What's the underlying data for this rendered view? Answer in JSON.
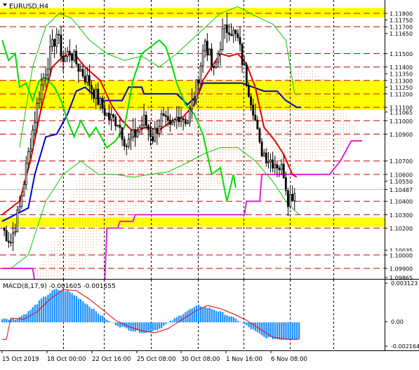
{
  "window": {
    "symbol_label": "EURUSD,H4"
  },
  "price_axis": {
    "labels": [
      "1.11800",
      "1.11750",
      "1.11700",
      "1.11650",
      "1.11500",
      "1.11400",
      "1.11350",
      "1.11300",
      "1.11250",
      "1.11200",
      "1.11100",
      "1.11065",
      "1.11000",
      "1.10900",
      "1.10700",
      "1.10600",
      "1.10550",
      "1.10487",
      "1.10400",
      "1.10300",
      "1.10200",
      "1.10035",
      "1.10000",
      "1.09900",
      "1.09865"
    ],
    "level_labels": [
      "1.11800",
      "1.11700",
      "1.11500",
      "1.11400",
      "1.11300",
      "1.11200",
      "1.11100",
      "1.11000",
      "1.10900",
      "1.10700",
      "1.10600",
      "1.10400",
      "1.10300",
      "1.10200",
      "1.10000",
      "1.09900"
    ],
    "current_price": "1.10487"
  },
  "support_resistance": {
    "levels": [
      1.118,
      1.117,
      1.115,
      1.114,
      1.113,
      1.112,
      1.111,
      1.11,
      1.109,
      1.107,
      1.106,
      1.104,
      1.103,
      1.102,
      1.1,
      1.099
    ],
    "zones": [
      [
        1.1177,
        1.1184
      ],
      [
        1.1108,
        1.113
      ],
      [
        1.1021,
        1.1028
      ]
    ],
    "zone_color": "#ffff00",
    "line_color": "#cc0000"
  },
  "macd": {
    "label": "MACD(8,17,9) -0.001605 -0.001655",
    "axis_labels": [
      "0.003123",
      "0.00",
      "-0.002164"
    ],
    "histogram_color": "#1e90ff",
    "signal_color": "#e00000"
  },
  "time_axis": {
    "labels": [
      "15 Oct 2019",
      "18 Oct 00:00",
      "22 Oct 16:00",
      "25 Oct 08:00",
      "30 Oct 08:00",
      "1 Nov 16:00",
      "6 Nov 08:00"
    ]
  },
  "colors": {
    "candles": "#000000",
    "chikou_span": "#00dd00",
    "tenkan_sen": "#e00000",
    "kijun_sen": "#0000cc",
    "senkou_b": "#dd22dd",
    "cloud_dots": "#e8a878",
    "envelope": "#00cc00"
  }
}
